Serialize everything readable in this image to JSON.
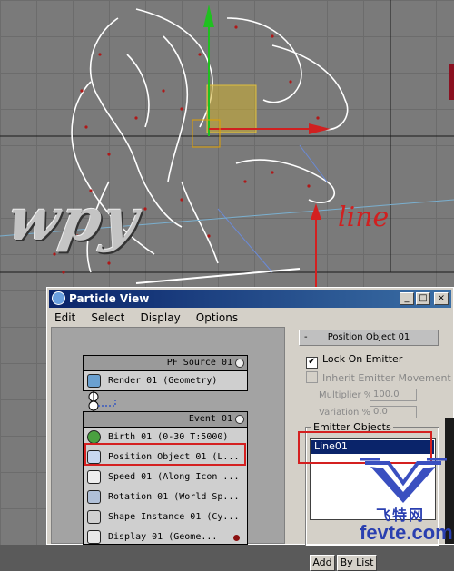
{
  "viewport": {
    "watermark_text": "wpy",
    "annotation_text": "line"
  },
  "window": {
    "title": "Particle View",
    "buttons": {
      "minimize": "_",
      "maximize": "□",
      "close": "×"
    }
  },
  "menu": [
    "Edit",
    "Select",
    "Display",
    "Options"
  ],
  "graph": {
    "source": {
      "header": "PF Source 01",
      "operators": [
        {
          "label": "Render 01  (Geometry)",
          "icon": "render-icon"
        }
      ]
    },
    "event": {
      "header": "Event 01",
      "operators": [
        {
          "label": "Birth 01  (0-30 T:5000)",
          "icon": "birth-icon"
        },
        {
          "label": "Position Object 01  (L...",
          "icon": "position-object-icon",
          "selected": true
        },
        {
          "label": "Speed 01  (Along Icon ...",
          "icon": "speed-icon"
        },
        {
          "label": "Rotation 01  (World Sp...",
          "icon": "rotation-icon"
        },
        {
          "label": "Shape Instance 01  (Cy...",
          "icon": "shape-instance-icon"
        },
        {
          "label": "Display 01  (Geome...",
          "icon": "display-icon"
        }
      ]
    }
  },
  "panel": {
    "rollout_title": "Position Object 01",
    "rollout_toggle": "-",
    "lock_on_emitter": {
      "label": "Lock On Emitter",
      "checked": true
    },
    "inherit_emitter_movement": {
      "label": "Inherit Emitter Movement",
      "checked": false
    },
    "multiplier": {
      "label": "Multiplier %",
      "value": "100.0"
    },
    "variation": {
      "label": "Variation %",
      "value": "0.0"
    },
    "emitter_objects_label": "Emitter Objects",
    "emitter_list": [
      "Line01"
    ],
    "add_button": "Add",
    "by_list_button": "By List"
  },
  "logo": {
    "chinese": "飞特网",
    "site": "fevte.com"
  },
  "colors": {
    "title_bar": "#0a246a",
    "selection": "#0a246a",
    "annotation_red": "#d42020",
    "logo_blue": "#2a3fb0"
  }
}
